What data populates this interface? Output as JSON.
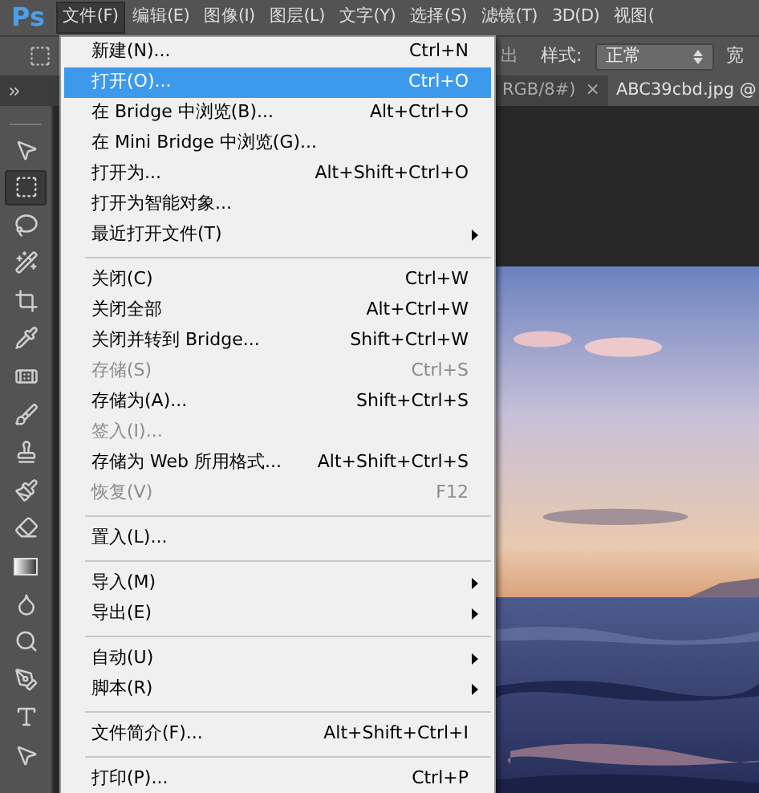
{
  "logo": "Ps",
  "menu_bar": [
    {
      "label": "文件(F)",
      "selected": true
    },
    {
      "label": "编辑(E)",
      "selected": false
    },
    {
      "label": "图像(I)",
      "selected": false
    },
    {
      "label": "图层(L)",
      "selected": false
    },
    {
      "label": "文字(Y)",
      "selected": false
    },
    {
      "label": "选择(S)",
      "selected": false
    },
    {
      "label": "滤镜(T)",
      "selected": false
    },
    {
      "label": "3D(D)",
      "selected": false
    },
    {
      "label": "视图(",
      "selected": false
    }
  ],
  "options_bar": {
    "partial_label": "出",
    "style_label": "样式:",
    "style_value": "正常",
    "cut_label": "宽"
  },
  "tabs": [
    {
      "label": "RGB/8#)",
      "close": "×",
      "selected": false
    },
    {
      "label": "ABC39cbd.jpg @",
      "selected": true
    }
  ],
  "toolbar": {
    "tools": [
      {
        "kind": "move",
        "selected": false
      },
      {
        "kind": "marquee",
        "selected": true
      },
      {
        "kind": "lasso",
        "selected": false
      },
      {
        "kind": "quick_select",
        "selected": false
      },
      {
        "kind": "crop",
        "selected": false
      },
      {
        "kind": "eyedropper",
        "selected": false
      },
      {
        "kind": "healing",
        "selected": false
      },
      {
        "kind": "brush",
        "selected": false
      },
      {
        "kind": "stamp",
        "selected": false
      },
      {
        "kind": "history_brush",
        "selected": false
      },
      {
        "kind": "eraser",
        "selected": false
      },
      {
        "kind": "gradient",
        "selected": false
      },
      {
        "kind": "blur",
        "selected": false
      },
      {
        "kind": "dodge",
        "selected": false
      },
      {
        "kind": "pen",
        "selected": false
      },
      {
        "kind": "type",
        "selected": false
      },
      {
        "kind": "path_select",
        "selected": false
      }
    ]
  },
  "file_menu": [
    {
      "kind": "item",
      "label": "新建(N)...",
      "shortcut": "Ctrl+N",
      "selected": false,
      "disabled": false
    },
    {
      "kind": "item",
      "label": "打开(O)...",
      "shortcut": "Ctrl+O",
      "selected": true,
      "disabled": false
    },
    {
      "kind": "item",
      "label": "在 Bridge 中浏览(B)...",
      "shortcut": "Alt+Ctrl+O",
      "selected": false,
      "disabled": false
    },
    {
      "kind": "item",
      "label": "在 Mini Bridge 中浏览(G)...",
      "selected": false,
      "disabled": false
    },
    {
      "kind": "item",
      "label": "打开为...",
      "shortcut": "Alt+Shift+Ctrl+O",
      "selected": false,
      "disabled": false
    },
    {
      "kind": "item",
      "label": "打开为智能对象...",
      "selected": false,
      "disabled": false
    },
    {
      "kind": "item",
      "label": "最近打开文件(T)",
      "submenu": true,
      "selected": false,
      "disabled": false
    },
    {
      "kind": "separator"
    },
    {
      "kind": "item",
      "label": "关闭(C)",
      "shortcut": "Ctrl+W",
      "selected": false,
      "disabled": false
    },
    {
      "kind": "item",
      "label": "关闭全部",
      "shortcut": "Alt+Ctrl+W",
      "selected": false,
      "disabled": false
    },
    {
      "kind": "item",
      "label": "关闭并转到 Bridge...",
      "shortcut": "Shift+Ctrl+W",
      "selected": false,
      "disabled": false
    },
    {
      "kind": "item",
      "label": "存储(S)",
      "shortcut": "Ctrl+S",
      "selected": false,
      "disabled": true
    },
    {
      "kind": "item",
      "label": "存储为(A)...",
      "shortcut": "Shift+Ctrl+S",
      "selected": false,
      "disabled": false
    },
    {
      "kind": "item",
      "label": "签入(I)...",
      "selected": false,
      "disabled": true
    },
    {
      "kind": "item",
      "label": "存储为 Web 所用格式...",
      "shortcut": "Alt+Shift+Ctrl+S",
      "selected": false,
      "disabled": false
    },
    {
      "kind": "item",
      "label": "恢复(V)",
      "shortcut": "F12",
      "selected": false,
      "disabled": true
    },
    {
      "kind": "separator"
    },
    {
      "kind": "item",
      "label": "置入(L)...",
      "selected": false,
      "disabled": false
    },
    {
      "kind": "separator"
    },
    {
      "kind": "item",
      "label": "导入(M)",
      "submenu": true,
      "selected": false,
      "disabled": false
    },
    {
      "kind": "item",
      "label": "导出(E)",
      "submenu": true,
      "selected": false,
      "disabled": false
    },
    {
      "kind": "separator"
    },
    {
      "kind": "item",
      "label": "自动(U)",
      "submenu": true,
      "selected": false,
      "disabled": false
    },
    {
      "kind": "item",
      "label": "脚本(R)",
      "submenu": true,
      "selected": false,
      "disabled": false
    },
    {
      "kind": "separator"
    },
    {
      "kind": "item",
      "label": "文件简介(F)...",
      "shortcut": "Alt+Shift+Ctrl+I",
      "selected": false,
      "disabled": false
    },
    {
      "kind": "separator"
    },
    {
      "kind": "item",
      "label": "打印(P)...",
      "shortcut": "Ctrl+P",
      "selected": false,
      "disabled": false
    }
  ]
}
